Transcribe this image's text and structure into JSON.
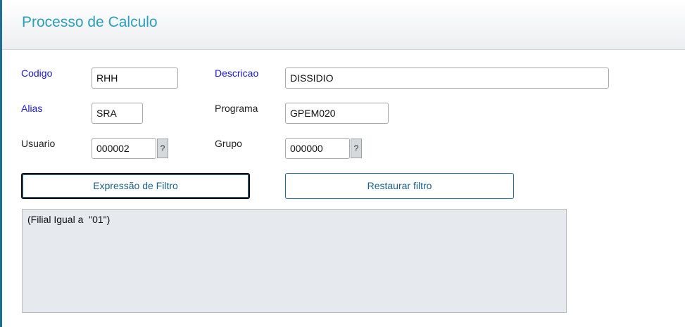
{
  "header": {
    "title": "Processo de Calculo"
  },
  "form": {
    "codigo": {
      "label": "Codigo",
      "value": "RHH"
    },
    "descricao": {
      "label": "Descricao",
      "value": "DISSIDIO"
    },
    "alias": {
      "label": "Alias",
      "value": "SRA"
    },
    "programa": {
      "label": "Programa",
      "value": "GPEM020"
    },
    "usuario": {
      "label": "Usuario",
      "value": "000002",
      "lookup": "?"
    },
    "grupo": {
      "label": "Grupo",
      "value": "000000",
      "lookup": "?"
    }
  },
  "buttons": {
    "filter_expression": "Expressão de Filtro",
    "restore_filter": "Restaurar filtro"
  },
  "filter": {
    "expression": "(Filial Igual a  \"01\")"
  },
  "colors": {
    "title": "#2a9fc0",
    "required_label": "#1a1acc",
    "accent": "#1c6e92"
  }
}
